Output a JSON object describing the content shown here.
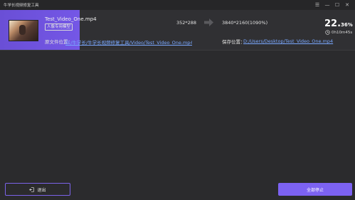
{
  "app": {
    "title": "牛学长视频修复工具"
  },
  "window_controls": [
    {
      "name": "menu-icon",
      "glyph": "☰"
    },
    {
      "name": "minimize-icon",
      "glyph": "—"
    },
    {
      "name": "maximize-icon",
      "glyph": "☐"
    },
    {
      "name": "close-icon",
      "glyph": "✕"
    }
  ],
  "task": {
    "file_name": "Test_Video_One.mp4",
    "model_badge": "人像专用模型",
    "source_resolution": "352*288",
    "target_resolution": "3840*2160(1090%)",
    "progress_percent_int": "22.",
    "progress_percent_dec": "36%",
    "progress_fraction": 0.2236,
    "time_remaining": "0h10m45s",
    "source_path_label": "原文件位置：",
    "source_path": "D:/牛学长/牛学长视频修复工具/Video/Test_Video_One.mp4",
    "save_path_label": "保存位置：",
    "save_path": "D:/Users/Desktop/Test_Video_One.mp4",
    "accent": "#7457e6"
  },
  "footer": {
    "exit_label": "退出",
    "stop_all_label": "全部停止"
  }
}
